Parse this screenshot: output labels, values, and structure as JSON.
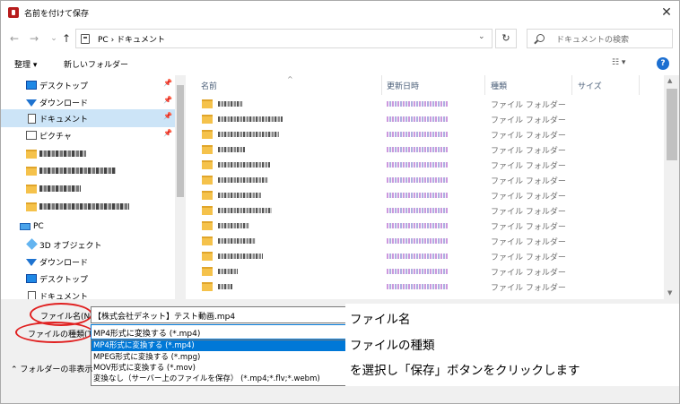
{
  "window": {
    "title": "名前を付けて保存",
    "close_icon": "close-icon"
  },
  "address": {
    "path": "PC › ドキュメント",
    "search_placeholder": "ドキュメントの検索",
    "back": "←",
    "forward": "→",
    "recent": "⌄",
    "up": "↑",
    "dropdown": "⌄",
    "refresh": "↻"
  },
  "toolbar": {
    "organize": "整理 ▾",
    "new_folder": "新しいフォルダー",
    "view": "☷ ▾",
    "help": "?"
  },
  "nav": {
    "items": [
      {
        "label": "デスクトップ",
        "icon": "desktop-icon"
      },
      {
        "label": "ダウンロード",
        "icon": "download-icon"
      },
      {
        "label": "ドキュメント",
        "icon": "document-icon"
      },
      {
        "label": "ピクチャ",
        "icon": "picture-icon"
      },
      {
        "label": "",
        "icon": "folder-icon"
      },
      {
        "label": "",
        "icon": "folder-icon"
      },
      {
        "label": "",
        "icon": "folder-icon"
      },
      {
        "label": "",
        "icon": "folder-icon"
      },
      {
        "label": "PC",
        "icon": "pc-icon"
      },
      {
        "label": "3D オブジェクト",
        "icon": "3d-objects-icon"
      },
      {
        "label": "ダウンロード",
        "icon": "download-icon"
      },
      {
        "label": "デスクトップ",
        "icon": "desktop-icon"
      },
      {
        "label": "ドキュメント",
        "icon": "document-icon"
      }
    ]
  },
  "filelist": {
    "columns": [
      "名前",
      "更新日時",
      "種類",
      "サイズ"
    ],
    "folder_type": "ファイル フォルダー",
    "row_count": 13
  },
  "form": {
    "filename_label": "ファイル名(N):",
    "filename_value": "【株式会社デネット】テスト動画.mp4",
    "filetype_label": "ファイルの種類(T):",
    "filetype_value": "MP4形式に変換する (*.mp4)",
    "hide_folders": "フォルダーの非表示",
    "options": [
      "MP4形式に変換する (*.mp4)",
      "MPEG形式に変換する (*.mpg)",
      "MOV形式に変換する (*.mov)",
      "変換なし（サーバー上のファイルを保存） (*.mp4;*.flv;*.webm)"
    ],
    "selected_option": 0
  },
  "annotation": {
    "line1": "ファイル名",
    "line2": "ファイルの種類",
    "line3": "を選択し「保存」ボタンをクリックします"
  },
  "colors": {
    "accent": "#0078d7",
    "highlight_ellipse": "#e02020"
  }
}
